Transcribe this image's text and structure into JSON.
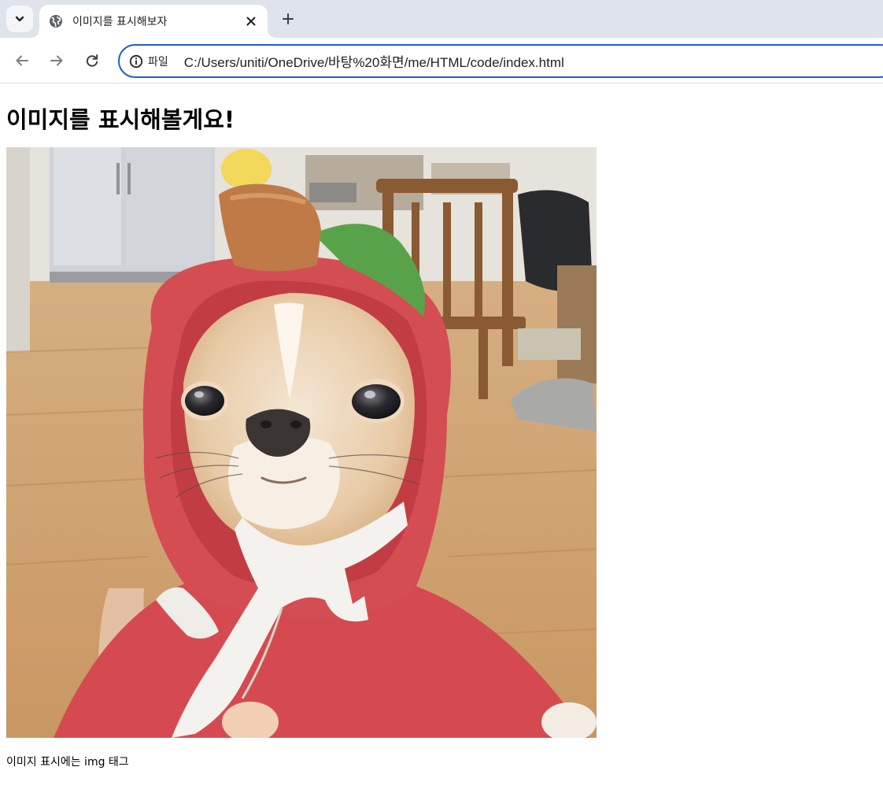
{
  "browser": {
    "tab": {
      "title": "이미지를 표시해보자",
      "favicon": "globe-icon",
      "close_icon": "close-icon"
    },
    "tab_search_icon": "chevron-down-icon",
    "new_tab_icon": "plus-icon",
    "toolbar": {
      "back_icon": "arrow-left-icon",
      "forward_icon": "arrow-right-icon",
      "reload_icon": "reload-icon",
      "omnibox": {
        "info_icon": "info-icon",
        "scheme_label": "파일",
        "url": "C:/Users/uniti/OneDrive/바탕%20화면/me/HTML/code/index.html"
      }
    },
    "accent_color": "#1a5fcb"
  },
  "page": {
    "heading": "이미지를 표시해볼게요!",
    "image": {
      "subject": "chihuahua wearing a red hoodie"
    },
    "caption": "이미지 표시에는 img 태그"
  }
}
